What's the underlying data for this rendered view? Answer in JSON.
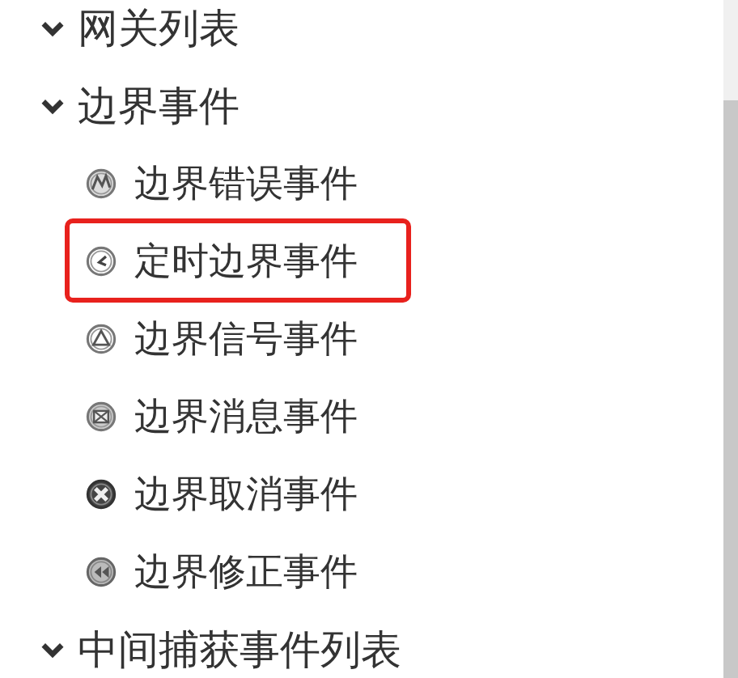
{
  "groups": [
    {
      "label": "网关列表",
      "expanded": true
    },
    {
      "label": "边界事件",
      "expanded": true,
      "items": [
        {
          "label": "边界错误事件",
          "kind": "error",
          "selected": false
        },
        {
          "label": "定时边界事件",
          "kind": "timer",
          "selected": true
        },
        {
          "label": "边界信号事件",
          "kind": "signal",
          "selected": false
        },
        {
          "label": "边界消息事件",
          "kind": "message",
          "selected": false
        },
        {
          "label": "边界取消事件",
          "kind": "cancel",
          "selected": false
        },
        {
          "label": "边界修正事件",
          "kind": "compensation",
          "selected": false
        }
      ]
    },
    {
      "label": "中间捕获事件列表",
      "expanded": true
    }
  ]
}
